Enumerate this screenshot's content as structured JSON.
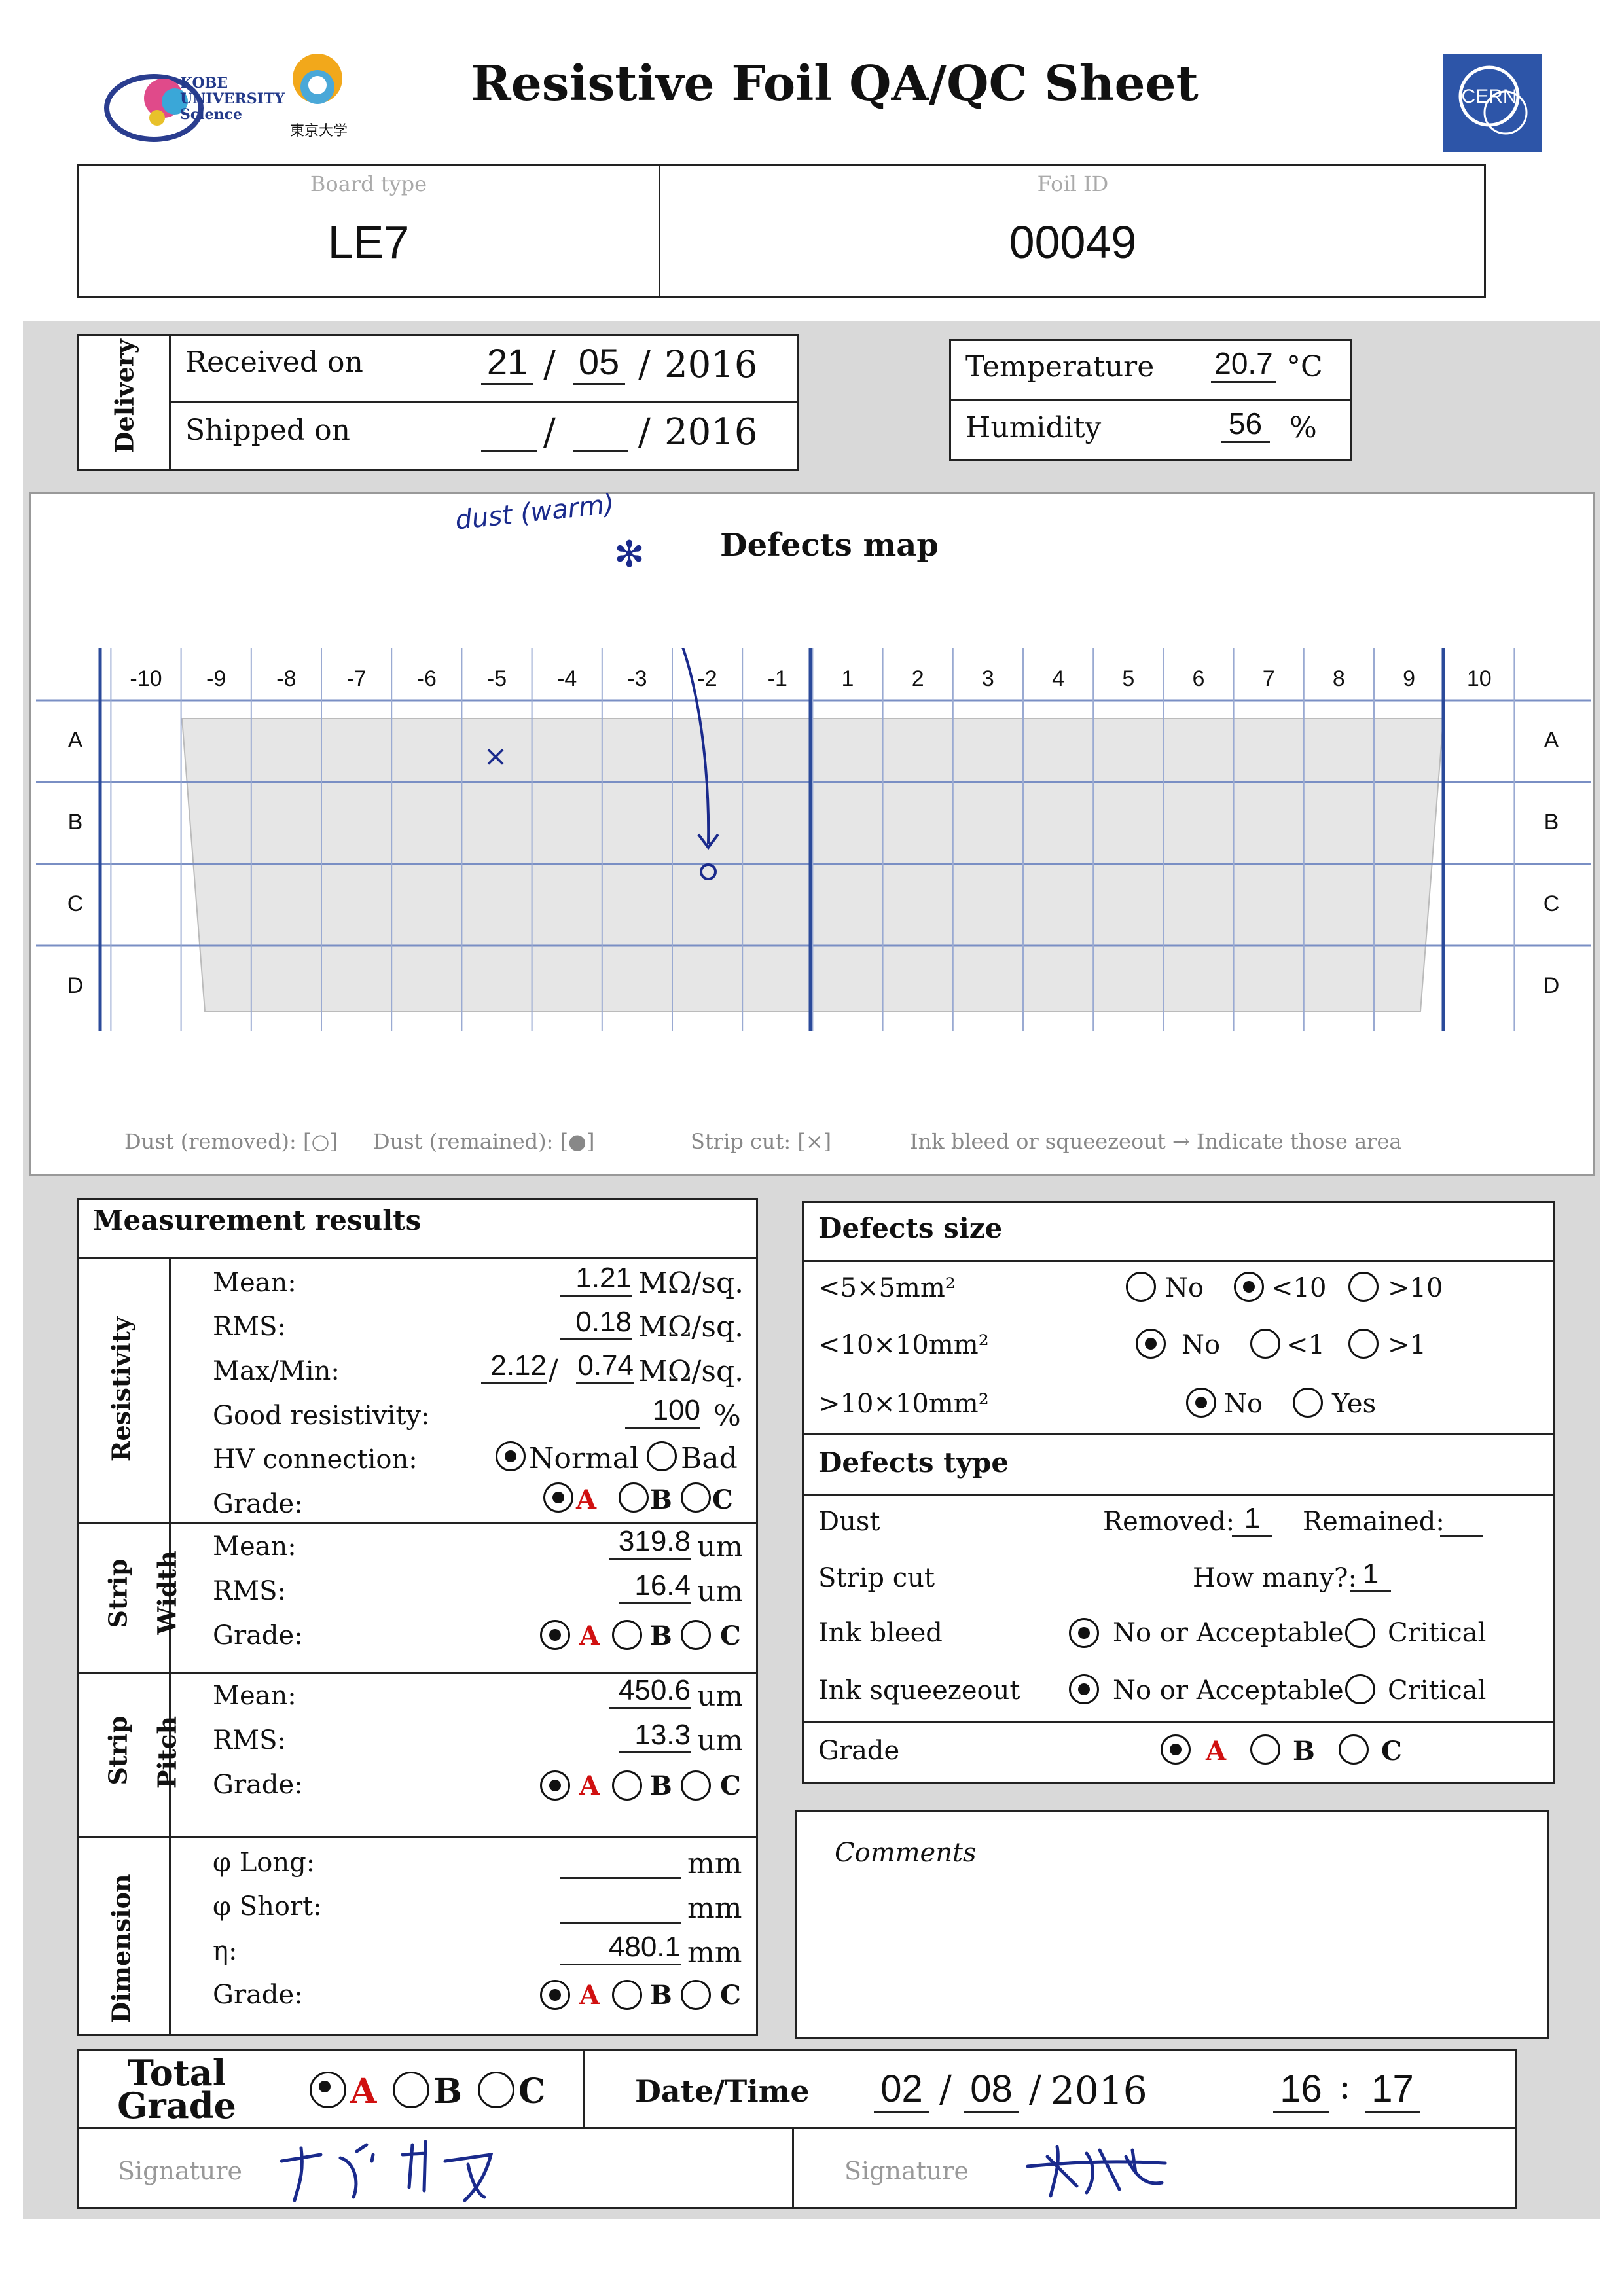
{
  "header": {
    "title": "Resistive Foil QA/QC Sheet",
    "logo_left_text": "KOBE UNIVERSITY Science",
    "logo_mid_text": "東京大学",
    "logo_right_text": "CERN",
    "board_type_label": "Board type",
    "board_type_value": "LE7",
    "foil_id_label": "Foil ID",
    "foil_id_value": "00049"
  },
  "delivery": {
    "section_label": "Delivery",
    "received_label": "Received on",
    "received_day": "21",
    "received_month": "05",
    "received_year": "2016",
    "shipped_label": "Shipped on",
    "shipped_day": "",
    "shipped_month": "",
    "shipped_year": "2016",
    "sep": "/"
  },
  "environment": {
    "temperature_label": "Temperature",
    "temperature_value": "20.7",
    "temperature_unit": "°C",
    "humidity_label": "Humidity",
    "humidity_value": "56",
    "humidity_unit": "%"
  },
  "defects_map": {
    "title": "Defects map",
    "columns": [
      "-10",
      "-9",
      "-8",
      "-7",
      "-6",
      "-5",
      "-4",
      "-3",
      "-2",
      "-1",
      "1",
      "2",
      "3",
      "4",
      "5",
      "6",
      "7",
      "8",
      "9",
      "10"
    ],
    "rows": [
      "A",
      "B",
      "C",
      "D"
    ],
    "annotation_text": "dust (warm)",
    "legend": [
      "Dust (removed): [○]",
      "Dust (remained): [●]",
      "Strip cut: [×]",
      "Ink bleed or squeezeout → Indicate those area"
    ]
  },
  "measurement": {
    "title": "Measurement results",
    "resistivity": {
      "label": "Resistivity",
      "mean_label": "Mean:",
      "mean_value": "1.21",
      "unit": "MΩ/sq.",
      "rms_label": "RMS:",
      "rms_value": "0.18",
      "maxmin_label": "Max/Min:",
      "max_value": "2.12",
      "min_value": "0.74",
      "maxmin_sep": "/",
      "good_label": "Good resistivity:",
      "good_value": "100",
      "good_unit": "%",
      "hv_label": "HV connection:",
      "hv_normal": "Normal",
      "hv_bad": "Bad",
      "grade_label": "Grade:"
    },
    "strip_width": {
      "label_1": "Strip",
      "label_2": "Width",
      "mean_label": "Mean:",
      "mean_value": "319.8",
      "unit": "um",
      "rms_label": "RMS:",
      "rms_value": "16.4",
      "grade_label": "Grade:"
    },
    "strip_pitch": {
      "label_1": "Strip",
      "label_2": "Pitch",
      "mean_label": "Mean:",
      "mean_value": "450.6",
      "unit": "um",
      "rms_label": "RMS:",
      "rms_value": "13.3",
      "grade_label": "Grade:"
    },
    "dimension": {
      "label": "Dimension",
      "phi_long_label": "φ Long:",
      "phi_long_value": "",
      "unit": "mm",
      "phi_short_label": "φ Short:",
      "phi_short_value": "",
      "eta_label": "η:",
      "eta_value": "480.1",
      "grade_label": "Grade:"
    },
    "grade_options": [
      "A",
      "B",
      "C"
    ]
  },
  "defects_size": {
    "title": "Defects size",
    "row1_label": "<5×5mm²",
    "row1_opts": [
      "No",
      "<10",
      ">10"
    ],
    "row2_label": "<10×10mm²",
    "row2_opts": [
      "No",
      "<1",
      ">1"
    ],
    "row3_label": ">10×10mm²",
    "row3_opts": [
      "No",
      "Yes"
    ]
  },
  "defects_type": {
    "title": "Defects type",
    "dust_label": "Dust",
    "removed_label": "Removed:",
    "removed_value": "1",
    "remained_label": "Remained:",
    "remained_value": "",
    "strip_cut_label": "Strip cut",
    "how_many_label": "How many?:",
    "how_many_value": "1",
    "ink_bleed_label": "Ink bleed",
    "ink_squeeze_label": "Ink squeezeout",
    "opt_ok": "No or Acceptable",
    "opt_critical": "Critical",
    "grade_label": "Grade",
    "grade_options": [
      "A",
      "B",
      "C"
    ]
  },
  "comments": {
    "label": "Comments"
  },
  "total": {
    "label_1": "Total",
    "label_2": "Grade",
    "grade_options": [
      "A",
      "B",
      "C"
    ],
    "datetime_label": "Date/Time",
    "day": "02",
    "month": "08",
    "year": "2016",
    "hour": "16",
    "minute": "17",
    "time_sep": ":",
    "signature_label": "Signature"
  }
}
